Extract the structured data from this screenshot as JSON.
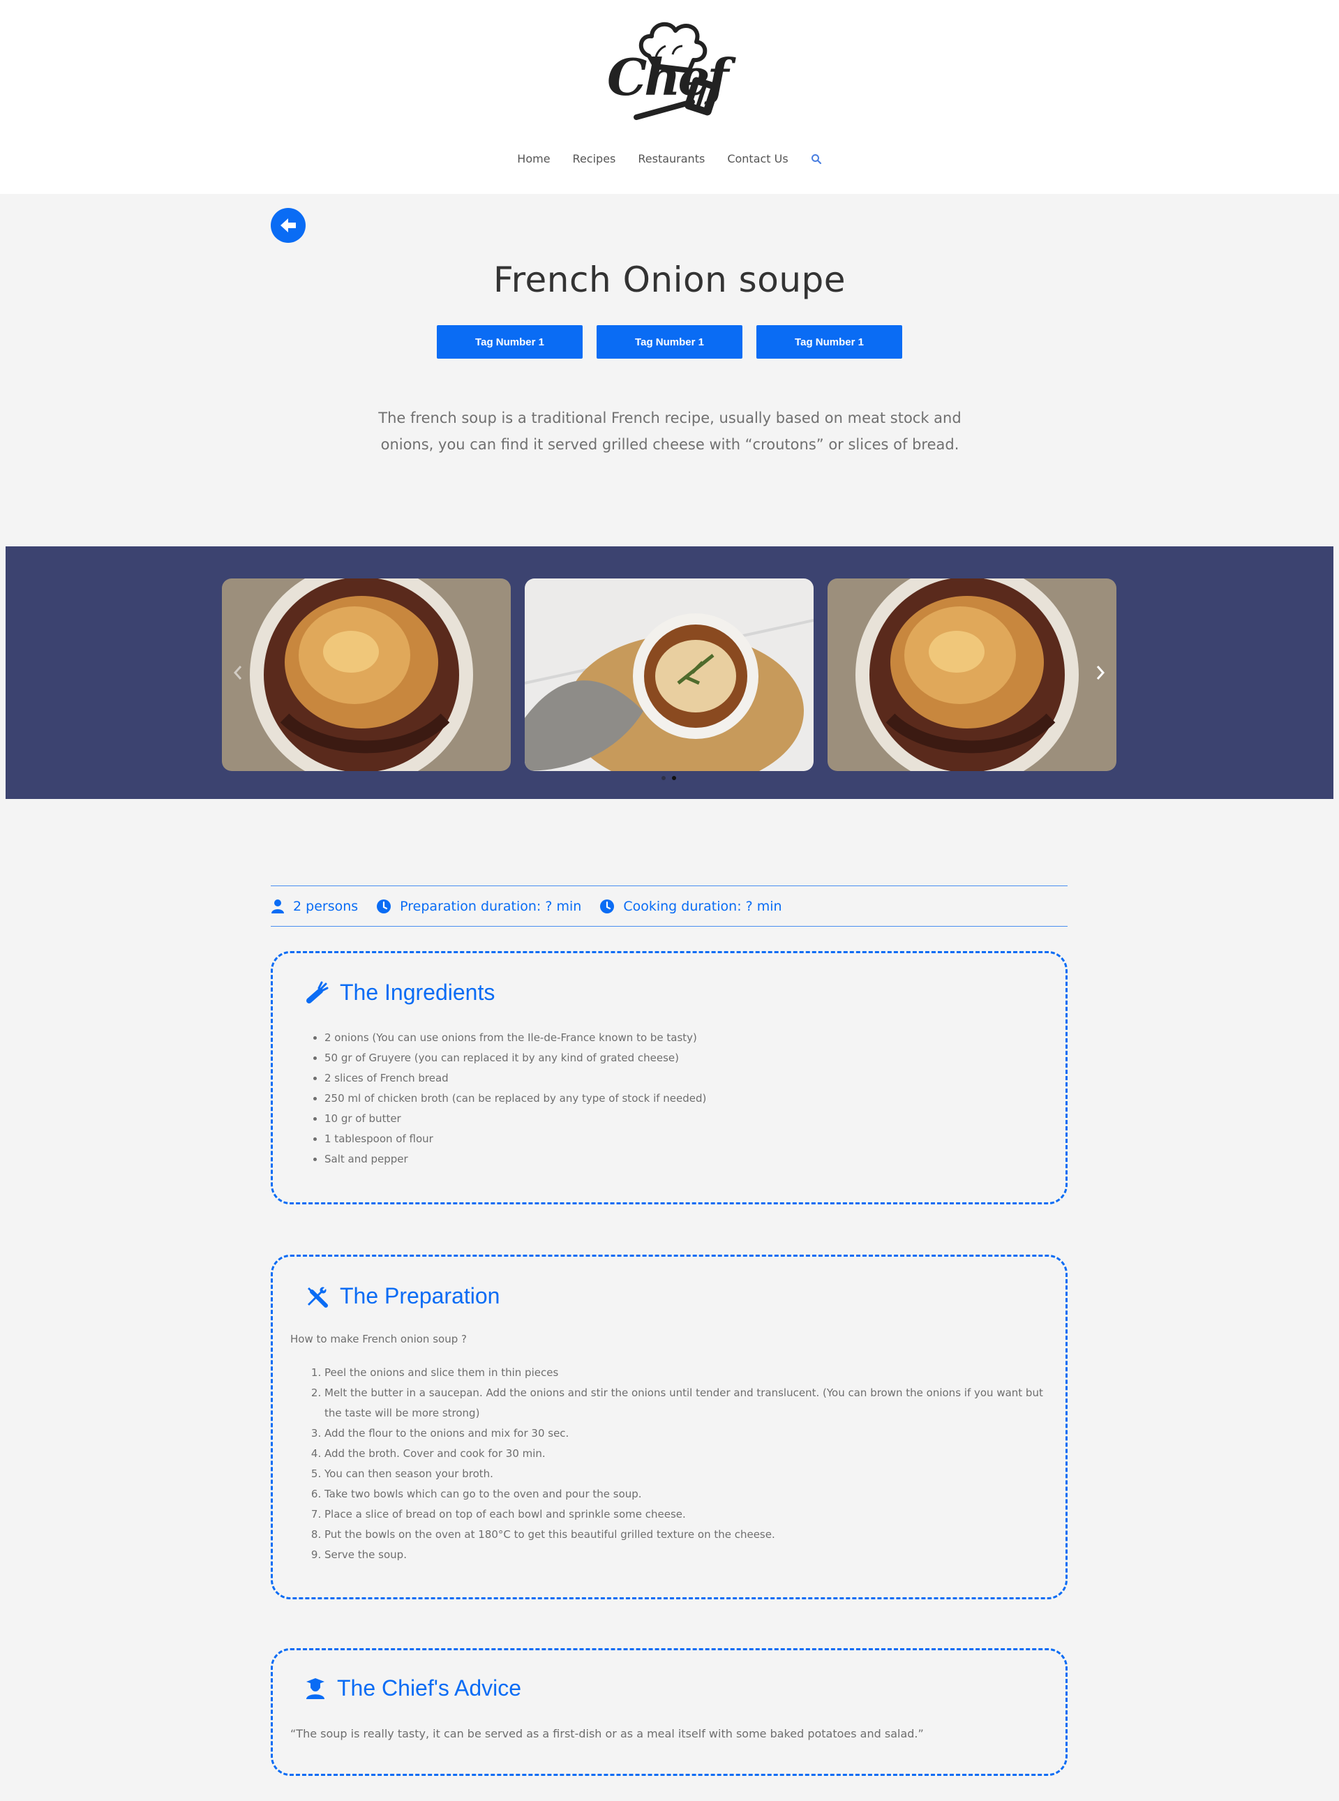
{
  "header": {
    "logo_text": "Chef",
    "nav": {
      "home": "Home",
      "recipes": "Recipes",
      "restaurants": "Restaurants",
      "contact": "Contact Us"
    }
  },
  "recipe": {
    "title": "French Onion soupe",
    "tags": [
      "Tag Number 1",
      "Tag Number 1",
      "Tag Number 1"
    ],
    "intro": "The french soup is a traditional French recipe, usually based on meat stock and onions, you can find it served grilled cheese with “croutons” or slices of bread."
  },
  "carousel": {
    "slides": 3,
    "active_dot": 1,
    "dot_count": 2
  },
  "meta": {
    "persons": "2 persons",
    "prep": "Preparation duration: ? min",
    "cook": "Cooking duration: ? min"
  },
  "ingredients": {
    "title": "The Ingredients",
    "items": [
      "2 onions (You can use onions from the Ile-de-France known to be tasty)",
      "50 gr of Gruyere (you can replaced it by any kind of grated cheese)",
      "2 slices of French bread",
      "250 ml of chicken broth (can be replaced by any type of stock if needed)",
      "10 gr of butter",
      "1 tablespoon of flour",
      "Salt and pepper"
    ]
  },
  "preparation": {
    "title": "The Preparation",
    "intro": "How to make French onion soup ?",
    "steps": [
      "Peel the onions and slice them in thin pieces",
      "Melt the butter in a saucepan. Add the onions and stir the onions until tender and translucent. (You can brown the onions if you want but the taste will be more strong)",
      "Add the flour to the onions and mix for 30 sec.",
      "Add the broth. Cover and cook for 30 min.",
      "You can then season your broth.",
      "Take two bowls which can go to the oven and pour the soup.",
      "Place a slice of bread on top of each bowl and sprinkle some cheese.",
      "Put the bowls on the oven at 180°C to get this beautiful grilled texture on the cheese.",
      "Serve the soup."
    ]
  },
  "advice": {
    "title": "The Chief's Advice",
    "text": "“The soup is really tasty, it can be served as a first-dish or as a meal itself with some baked potatoes and salad.”"
  },
  "colors": {
    "accent": "#0a6cf4",
    "carousel_bg": "#3c4370",
    "page_bg": "#f4f4f4"
  }
}
